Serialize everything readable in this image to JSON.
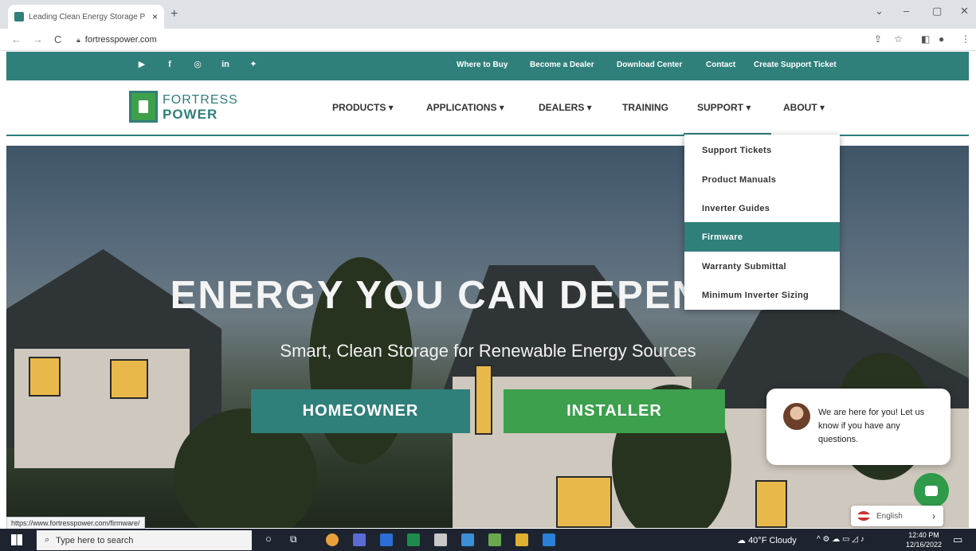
{
  "browser": {
    "tab_title": "Leading Clean Energy Storage P",
    "tab_close": "×",
    "new_tab": "+",
    "url": "fortresspower.com",
    "status_url": "https://www.fortresspower.com/firmware/"
  },
  "topbar": {
    "links": [
      "Where to Buy",
      "Become a Dealer",
      "Download Center",
      "Contact",
      "Create Support Ticket"
    ],
    "social_icons": [
      "youtube-icon",
      "facebook-icon",
      "instagram-icon",
      "linkedin-icon",
      "twitter-icon"
    ]
  },
  "header": {
    "logo_top": "FORTRESS",
    "logo_bottom": "POWER",
    "nav": [
      "PRODUCTS ▾",
      "APPLICATIONS ▾",
      "DEALERS ▾",
      "TRAINING",
      "SUPPORT ▾",
      "ABOUT ▾"
    ]
  },
  "support_menu": {
    "items": [
      "Support Tickets",
      "Product Manuals",
      "Inverter Guides",
      "Firmware",
      "Warranty Submittal",
      "Minimum Inverter Sizing"
    ],
    "active": "Firmware"
  },
  "hero": {
    "headline": "ENERGY YOU CAN DEPEND ON",
    "subheadline": "Smart, Clean Storage for Renewable Energy Sources",
    "button_homeowner": "HOMEOWNER",
    "button_installer": "INSTALLER"
  },
  "chat": {
    "message": "We are here for you! Let us know if you have any questions."
  },
  "language": {
    "label": "English"
  },
  "taskbar": {
    "search_placeholder": "Type here to search",
    "weather": "40°F Cloudy",
    "time": "12:40 PM",
    "date": "12/16/2022"
  },
  "colors": {
    "brand_teal": "#2f7f7a",
    "brand_green": "#3ca04c"
  }
}
